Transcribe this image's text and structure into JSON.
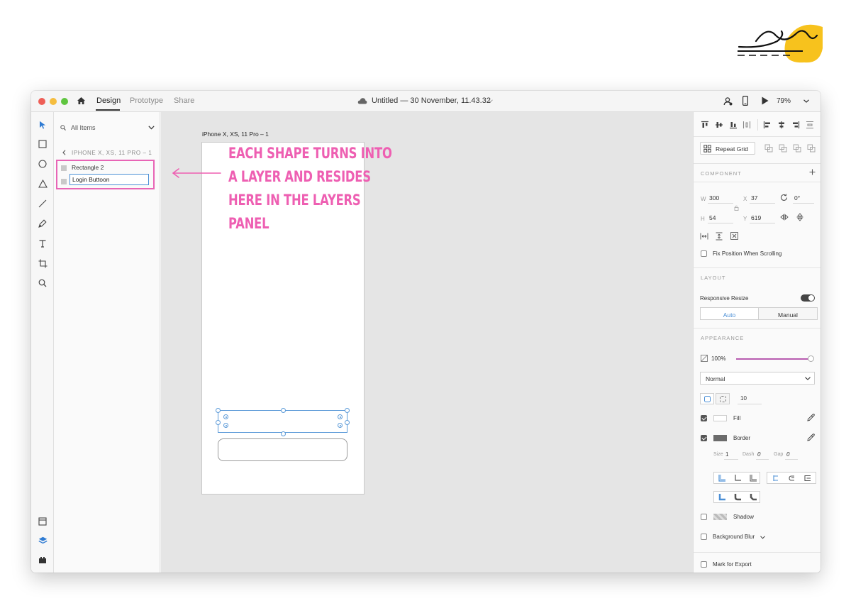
{
  "window": {
    "tabs": [
      {
        "label": "Design",
        "active": true
      },
      {
        "label": "Prototype",
        "active": false
      },
      {
        "label": "Share",
        "active": false
      }
    ],
    "document_title": "Untitled — 30 November, 11.43.32",
    "zoom": "79%"
  },
  "layers_panel": {
    "filter_label": "All Items",
    "artboard_name": "IPHONE X, XS, 11 PRO – 1",
    "layers": [
      {
        "label": "Rectangle 2"
      },
      {
        "label": "Login Buttoon",
        "editing": true
      }
    ]
  },
  "canvas": {
    "artboard_title": "iPhone X, XS, 11 Pro – 1",
    "annotation": "EACH SHAPE TURNS INTO A LAYER AND RESIDES HERE IN THE LAYERS PANEL",
    "annotation_color": "#EE5FB2"
  },
  "inspector": {
    "repeat_grid_label": "Repeat Grid",
    "component_title": "COMPONENT",
    "transform": {
      "w_label": "W",
      "w": "300",
      "x_label": "X",
      "x": "37",
      "rotation": "0°",
      "h_label": "H",
      "h": "54",
      "y_label": "Y",
      "y": "619"
    },
    "fix_position_label": "Fix Position When Scrolling",
    "layout_title": "LAYOUT",
    "responsive_resize_label": "Responsive Resize",
    "resize_modes": [
      "Auto",
      "Manual"
    ],
    "appearance_title": "APPEARANCE",
    "opacity": "100%",
    "blend_mode": "Normal",
    "corner_radius": "10",
    "fill_label": "Fill",
    "border_label": "Border",
    "border_size_label": "Size",
    "border_size": "1",
    "dash_label": "Dash",
    "dash": "0",
    "gap_label": "Gap",
    "gap": "0",
    "shadow_label": "Shadow",
    "background_blur_label": "Background Blur",
    "mark_for_export_label": "Mark for Export",
    "accent_color": "#4B8FD6",
    "toggle_color": "#444444",
    "slider_color": "#B85CB0"
  }
}
